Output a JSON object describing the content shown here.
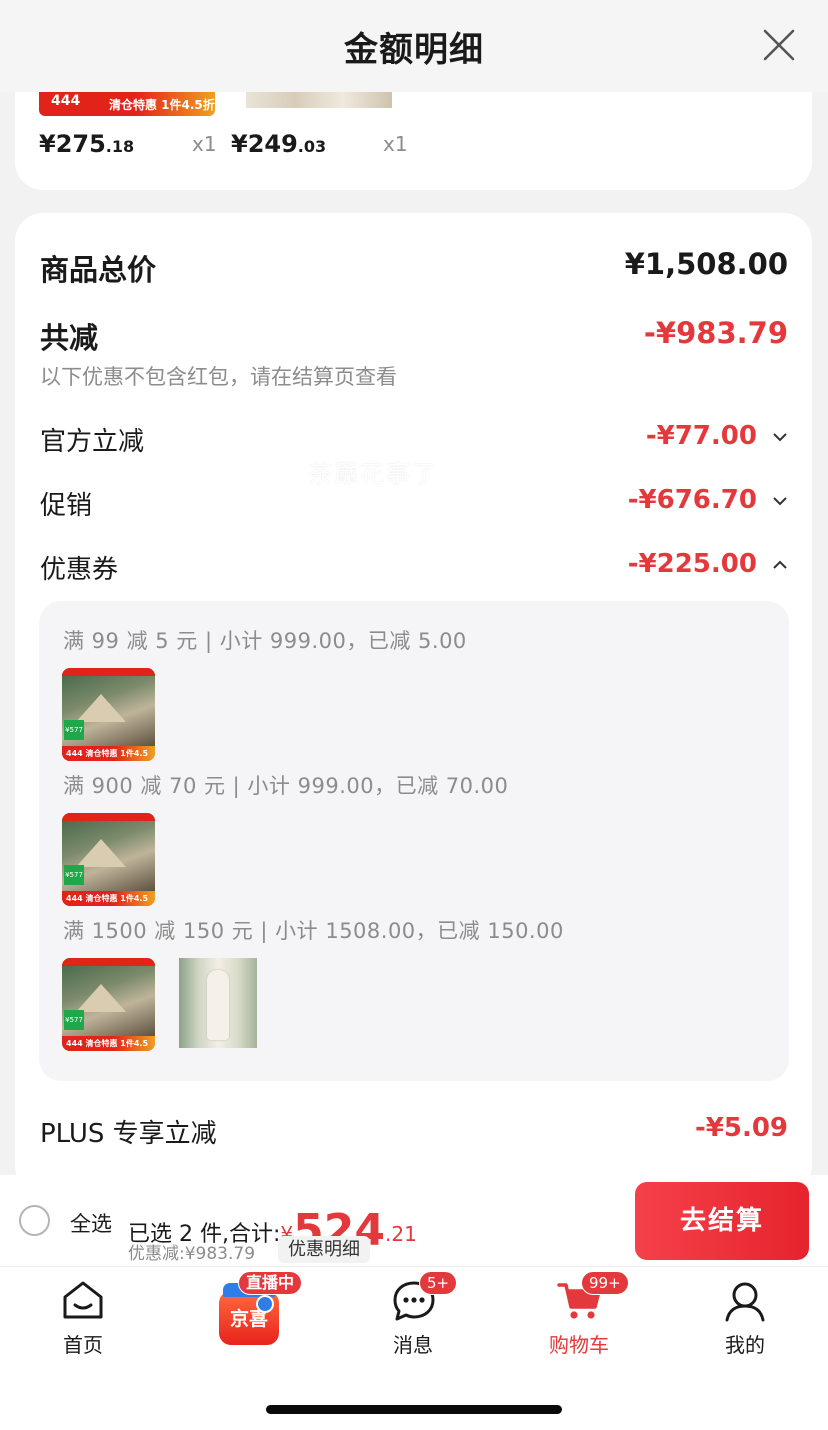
{
  "header": {
    "title": "金额明细"
  },
  "products": [
    {
      "price_int": "¥275",
      "price_dec": ".18",
      "qty": "x1",
      "badge_num": "444",
      "badge_text": "清仓特惠 1件4.5折"
    },
    {
      "price_int": "¥249",
      "price_dec": ".03",
      "qty": "x1"
    }
  ],
  "summary": {
    "total_label": "商品总价",
    "total_value": "¥1,508.00",
    "reduce_label": "共减",
    "reduce_value": "-¥983.79",
    "note": "以下优惠不包含红包，请在结算页查看",
    "official_label": "官方立减",
    "official_value": "-¥77.00",
    "promo_label": "促销",
    "promo_value": "-¥676.70",
    "coupon_label": "优惠券",
    "coupon_value": "-¥225.00",
    "plus_label": "PLUS 专享立减",
    "plus_value": "-¥5.09"
  },
  "coupons": [
    {
      "rule": "满 99 减 5 元 | 小计 999.00，已减 5.00"
    },
    {
      "rule": "满 900 减 70 元 | 小计 999.00，已减 70.00"
    },
    {
      "rule": "满 1500 减 150 元 | 小计 1508.00，已减 150.00"
    }
  ],
  "tile": {
    "num": "444",
    "sale": "清仓特惠 1件4.5折",
    "green": "¥577"
  },
  "watermark": "茶蘼花事了",
  "checkout": {
    "select_all": "全选",
    "selected_text": "已选 2 件,合计:",
    "currency": "¥",
    "total_int": "524",
    "total_dec": ".21",
    "discount_text": "优惠减:¥983.79",
    "detail_chip": "优惠明细",
    "button": "去结算"
  },
  "tabs": [
    {
      "label": "首页",
      "icon": "home-icon"
    },
    {
      "label": "京喜",
      "icon": "live-shop-icon",
      "badge": "直播中"
    },
    {
      "label": "消息",
      "icon": "message-icon",
      "badge": "5+"
    },
    {
      "label": "购物车",
      "icon": "cart-icon",
      "badge": "99+",
      "active": true
    },
    {
      "label": "我的",
      "icon": "user-icon"
    }
  ],
  "colors": {
    "accent": "#e4393c",
    "background": "#f2f2f2",
    "card": "#ffffff",
    "muted": "#8c8c8c"
  }
}
